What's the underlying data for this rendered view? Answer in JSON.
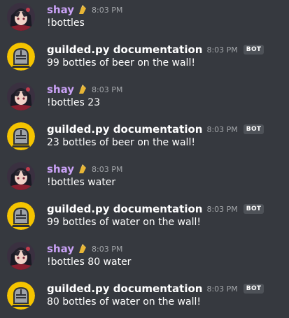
{
  "messages": [
    {
      "kind": "user",
      "author": "shay",
      "time": "8:03 PM",
      "content": "!bottles",
      "badge": ""
    },
    {
      "kind": "bot",
      "author": "guilded.py documentation",
      "time": "8:03 PM",
      "content": "99 bottles of beer on the wall!",
      "badge": "BOT"
    },
    {
      "kind": "user",
      "author": "shay",
      "time": "8:03 PM",
      "content": "!bottles 23",
      "badge": ""
    },
    {
      "kind": "bot",
      "author": "guilded.py documentation",
      "time": "8:03 PM",
      "content": "23 bottles of beer on the wall!",
      "badge": "BOT"
    },
    {
      "kind": "user",
      "author": "shay",
      "time": "8:03 PM",
      "content": "!bottles water",
      "badge": ""
    },
    {
      "kind": "bot",
      "author": "guilded.py documentation",
      "time": "8:03 PM",
      "content": "99 bottles of water on the wall!",
      "badge": "BOT"
    },
    {
      "kind": "user",
      "author": "shay",
      "time": "8:03 PM",
      "content": "!bottles 80 water",
      "badge": ""
    },
    {
      "kind": "bot",
      "author": "guilded.py documentation",
      "time": "8:03 PM",
      "content": "80 bottles of water on the wall!",
      "badge": "BOT"
    }
  ],
  "colors": {
    "background": "#36393f",
    "user_name": "#c9a1f5",
    "bot_name": "#ffffff",
    "timestamp": "#a3a6aa",
    "badge_bg": "#4e5258",
    "bot_avatar_bg": "#f5c400"
  },
  "icons": {
    "user_badge": "gift-icon",
    "bot_avatar": "knight-helmet-icon",
    "user_avatar": "anime-avatar"
  }
}
